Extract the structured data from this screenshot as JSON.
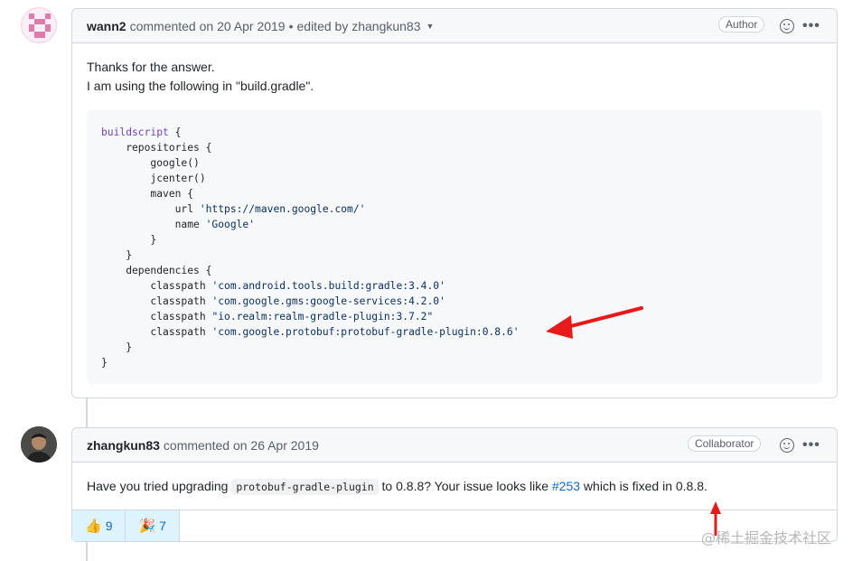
{
  "comment1": {
    "author": "wann2",
    "action": "commented on 20 Apr 2019",
    "edited": "edited by zhangkun83",
    "badge": "Author",
    "body_line1": "Thanks for the answer.",
    "body_line2": "I am using the following in \"build.gradle\".",
    "code": {
      "l1_kw": "buildscript",
      "l1_rest": " {",
      "l2": "    repositories {",
      "l3": "        google()",
      "l4": "        jcenter()",
      "l5": "        maven {",
      "l6_a": "            url ",
      "l6_s": "'https://maven.google.com/'",
      "l7_a": "            name ",
      "l7_s": "'Google'",
      "l8": "        }",
      "l9": "    }",
      "l10": "    dependencies {",
      "l11_a": "        classpath ",
      "l11_s": "'com.android.tools.build:gradle:3.4.0'",
      "l12_a": "        classpath ",
      "l12_s": "'com.google.gms:google-services:4.2.0'",
      "l13_a": "        classpath ",
      "l13_s": "\"io.realm:realm-gradle-plugin:3.7.2\"",
      "l14_a": "        classpath ",
      "l14_s": "'com.google.protobuf:protobuf-gradle-plugin:0.8.6'",
      "l15": "    }",
      "l16": "}"
    }
  },
  "comment2": {
    "author": "zhangkun83",
    "action": "commented on 26 Apr 2019",
    "badge": "Collaborator",
    "body_a": "Have you tried upgrading ",
    "body_code": "protobuf-gradle-plugin",
    "body_b": " to 0.8.8? Your issue looks like ",
    "body_link": "#253",
    "body_c": " which is fixed in 0.8.8.",
    "reactions": [
      {
        "emoji": "👍",
        "count": "9"
      },
      {
        "emoji": "🎉",
        "count": "7"
      }
    ]
  },
  "watermark": "@稀土掘金技术社区",
  "colors": {
    "arrow": "#e8191a",
    "link": "#0969da"
  }
}
